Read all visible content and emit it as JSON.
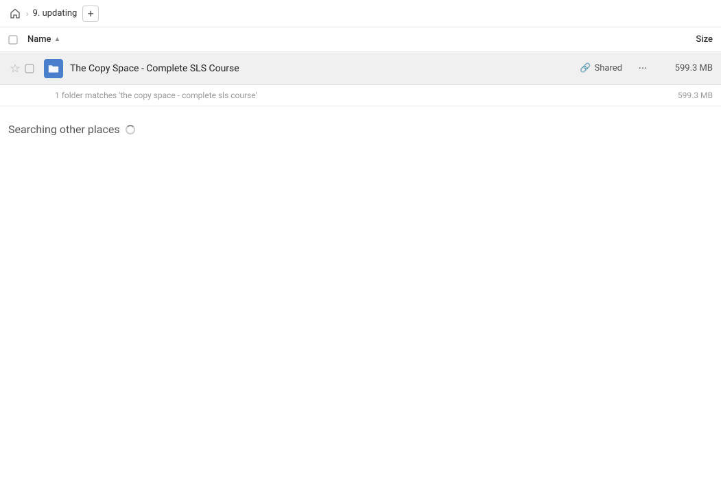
{
  "topbar": {
    "home_icon": "home",
    "breadcrumb": "9. updating",
    "add_button_label": "+"
  },
  "columns": {
    "name_label": "Name",
    "sort_indicator": "▲",
    "size_label": "Size"
  },
  "file_row": {
    "name": "The Copy Space - Complete SLS Course",
    "shared_label": "Shared",
    "size": "599.3 MB",
    "more_icon": "···"
  },
  "match_info": {
    "text": "1 folder matches 'the copy space - complete sls course'",
    "size": "599.3 MB"
  },
  "searching_section": {
    "label": "Searching other places"
  }
}
